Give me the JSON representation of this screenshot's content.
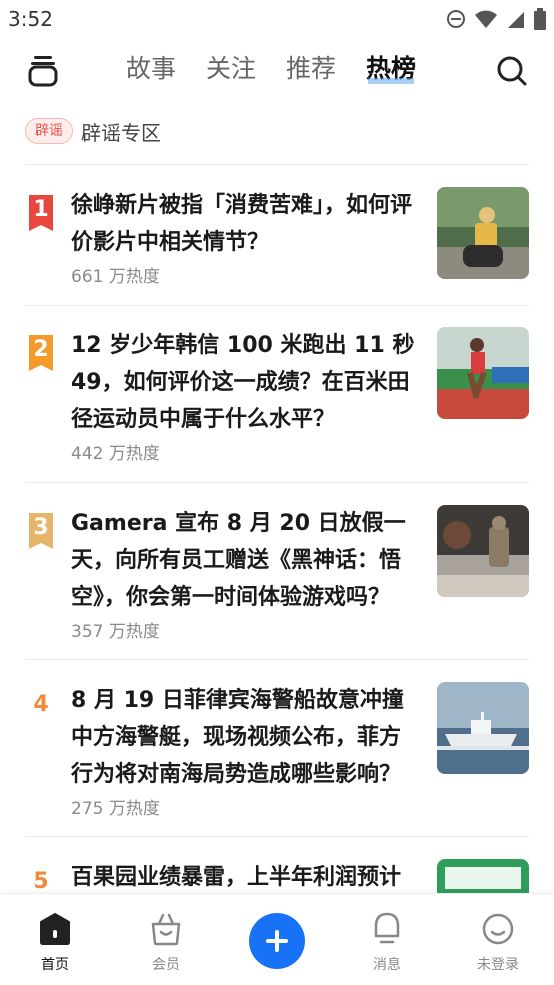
{
  "status_bar": {
    "time": "3:52"
  },
  "nav": {
    "tabs": [
      {
        "label": "故事",
        "active": false
      },
      {
        "label": "关注",
        "active": false
      },
      {
        "label": "推荐",
        "active": false
      },
      {
        "label": "热榜",
        "active": true
      }
    ]
  },
  "rumor": {
    "badge": "辟谣",
    "label": "辟谣专区"
  },
  "hot_list": [
    {
      "rank": "1",
      "title": "徐峥新片被指「消费苦难」，如何评价影片中相关情节？",
      "heat": "661 万热度"
    },
    {
      "rank": "2",
      "title": "12 岁少年韩信 100 米跑出 11 秒 49，如何评价这一成绩？在百米田径运动员中属于什么水平？",
      "heat": "442 万热度"
    },
    {
      "rank": "3",
      "title": "Gamera 宣布 8 月 20 日放假一天，向所有员工赠送《黑神话：悟空》，你会第一时间体验游戏吗？",
      "heat": "357 万热度"
    },
    {
      "rank": "4",
      "title": "8 月 19 日菲律宾海警船故意冲撞中方海警艇，现场视频公布，菲方行为将对南海局势造成哪些影响？",
      "heat": "275 万热度"
    },
    {
      "rank": "5",
      "title": "百果园业绩暴雷，上半年利润预计",
      "heat": ""
    }
  ],
  "bottom_nav": {
    "home": "首页",
    "member": "会员",
    "messages": "消息",
    "login": "未登录"
  },
  "colors": {
    "accent": "#1772f6",
    "rank1": "#e8473f",
    "rank2": "#f39a2c",
    "rank3": "#e4b56a",
    "rank_plain": "#f08a3c"
  }
}
